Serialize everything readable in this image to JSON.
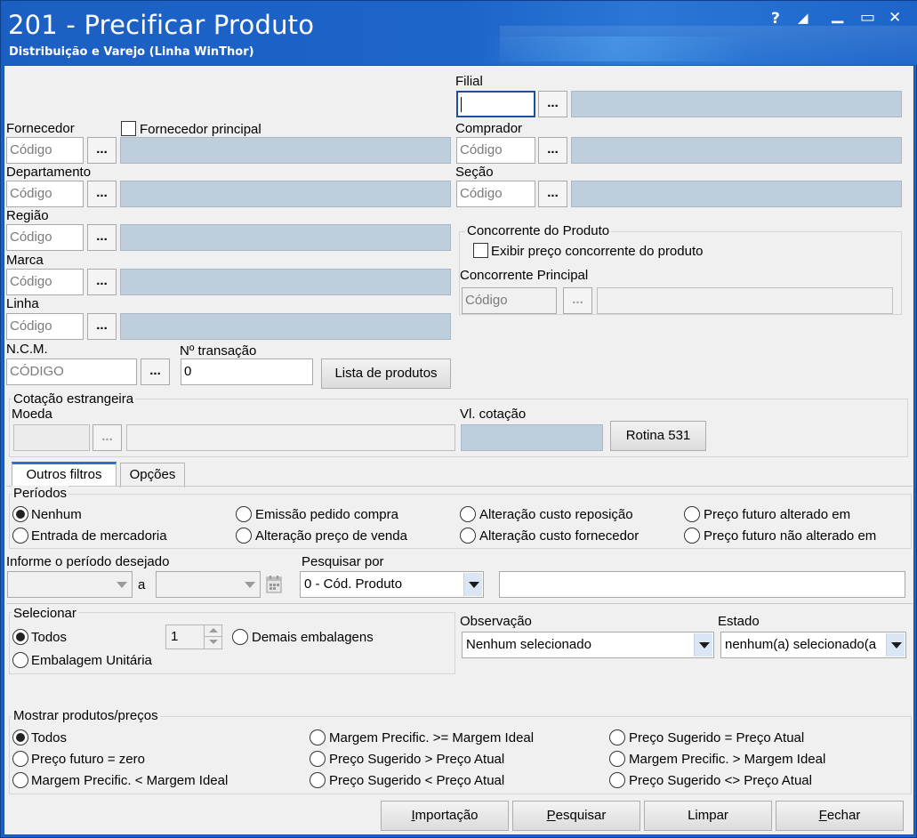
{
  "window": {
    "title": "201 - Precificar Produto",
    "subtitle": "Distribuição e Varejo (Linha WinThor)",
    "help": "?",
    "restore": "◢",
    "minimize": "▁",
    "maximize": "▭",
    "close": "✕"
  },
  "filters": {
    "filial_label": "Filial",
    "fornecedor_label": "Fornecedor",
    "fornecedor_principal_label": "Fornecedor principal",
    "comprador_label": "Comprador",
    "departamento_label": "Departamento",
    "secao_label": "Seção",
    "regiao_label": "Região",
    "marca_label": "Marca",
    "linha_label": "Linha",
    "ncm_label": "N.C.M.",
    "transacao_label": "Nº transação",
    "codigo_placeholder": "Código",
    "ncm_placeholder": "CÓDIGO",
    "transacao_value": "0",
    "dots": "...",
    "lista_produtos": "Lista de produtos"
  },
  "concorrente": {
    "legend": "Concorrente do Produto",
    "exibir_label": "Exibir preço concorrente do produto",
    "principal_label": "Concorrente Principal",
    "codigo_placeholder": "Código"
  },
  "cotacao": {
    "legend": "Cotação estrangeira",
    "moeda_label": "Moeda",
    "vl_label": "Vl. cotação",
    "rotina_button": "Rotina 531"
  },
  "tabs": [
    {
      "label": "Outros filtros",
      "active": true
    },
    {
      "label": "Opções",
      "active": false
    }
  ],
  "periodos": {
    "legend": "Períodos",
    "options": [
      "Nenhum",
      "Emissão pedido compra",
      "Alteração custo reposição",
      "Preço futuro alterado em",
      "Entrada de mercadoria",
      "Alteração preço de venda",
      "Alteração custo fornecedor",
      "Preço futuro não alterado em"
    ],
    "selected": "Nenhum"
  },
  "periodo_desejado": {
    "label": "Informe o período desejado",
    "a": "a"
  },
  "pesquisar_por": {
    "label": "Pesquisar por",
    "value": "0 - Cód. Produto"
  },
  "selecionar": {
    "legend": "Selecionar",
    "todos": "Todos",
    "embalagem_unitaria": "Embalagem Unitária",
    "demais_embalagens": "Demais embalagens",
    "quantity": "1",
    "selected": "Todos"
  },
  "observacao": {
    "label": "Observação",
    "value": "Nenhum selecionado"
  },
  "estado": {
    "label": "Estado",
    "value": "nenhum(a) selecionado(a"
  },
  "mostrar": {
    "legend": "Mostrar produtos/preços",
    "options": [
      "Todos",
      "Margem Precific. >= Margem Ideal",
      "Preço Sugerido = Preço Atual",
      "Preço futuro = zero",
      "Preço Sugerido > Preço Atual",
      "Margem Precific. > Margem Ideal",
      "Margem Precific. < Margem Ideal",
      "Preço Sugerido < Preço Atual",
      "Preço Sugerido <> Preço Atual"
    ],
    "selected": "Todos"
  },
  "footer": {
    "importacao_first": "I",
    "importacao_rest": "mportação",
    "pesquisar_first": "P",
    "pesquisar_rest": "esquisar",
    "limpar": "Limpar",
    "fechar_first": "F",
    "fechar_rest": "echar"
  },
  "colors": {
    "titlebar": "#1d64c9",
    "readonly_field": "#bfcedc",
    "tab_accent": "#2b6fd3"
  }
}
